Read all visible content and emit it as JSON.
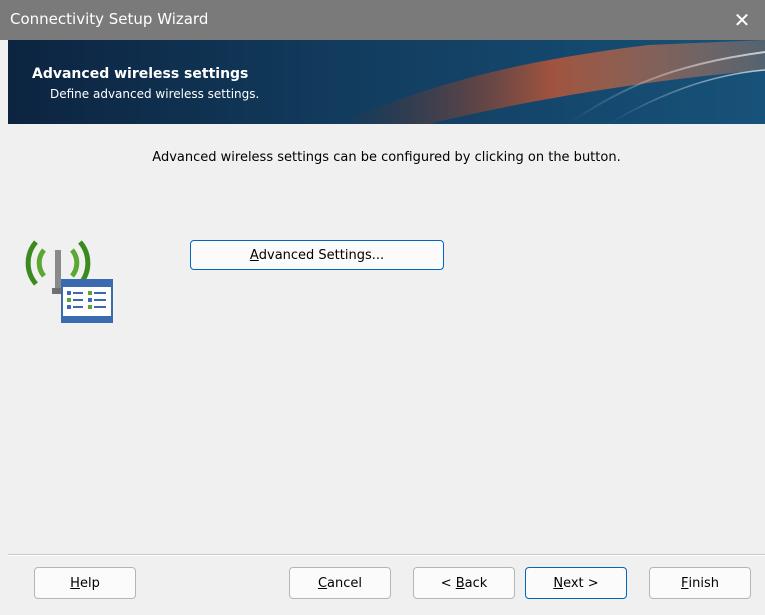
{
  "window": {
    "title": "Connectivity Setup Wizard",
    "close_glyph": "✕"
  },
  "banner": {
    "title": "Advanced wireless settings",
    "subtitle": "Define advanced wireless settings."
  },
  "main": {
    "instruction": "Advanced wireless settings can be configured by clicking on the button.",
    "advanced_button": {
      "mnemonic": "A",
      "rest": "dvanced Settings..."
    },
    "icon": "wireless-settings-icon"
  },
  "footer": {
    "help": {
      "mnemonic": "H",
      "rest": "elp"
    },
    "cancel": {
      "mnemonic": "C",
      "rest": "ancel"
    },
    "back": {
      "prefix": "< ",
      "mnemonic": "B",
      "rest": "ack"
    },
    "next": {
      "mnemonic": "N",
      "rest": "ext >"
    },
    "finish": {
      "mnemonic": "F",
      "rest": "inish"
    }
  },
  "colors": {
    "accent": "#0067c0",
    "banner_dark": "#0c2440",
    "titlebar": "#7a7a7a"
  }
}
